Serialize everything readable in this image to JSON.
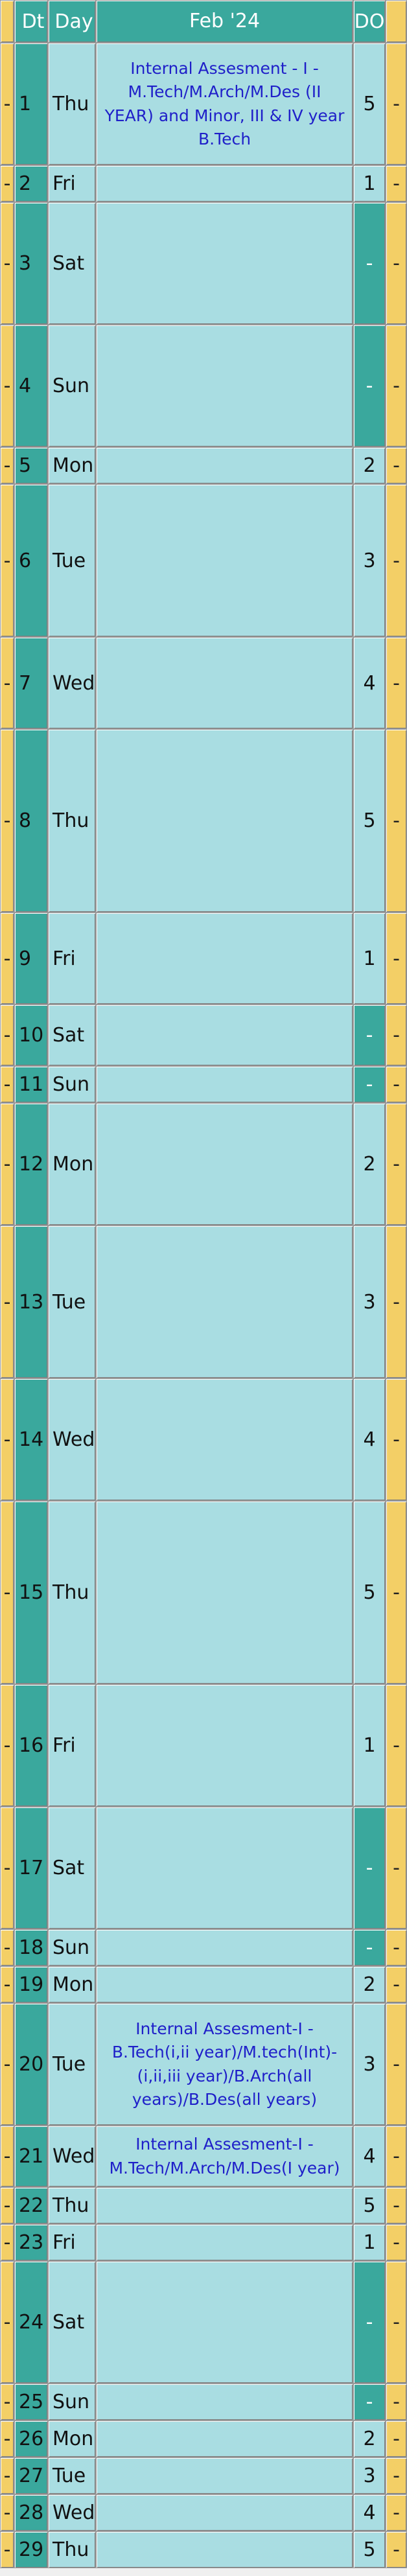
{
  "header": {
    "lead": "",
    "dt": "Dt",
    "day": "Day",
    "month": "Feb '24",
    "do": "DO",
    "trail": ""
  },
  "rows": [
    {
      "lead": "-",
      "dt": "1",
      "day": "Thu",
      "event": "Internal Assesment - I - M.Tech/M.Arch/M.Des (II YEAR) and Minor, III & IV year B.Tech",
      "do": "5",
      "trail": "-",
      "holiday": false
    },
    {
      "lead": "-",
      "dt": "2",
      "day": "Fri",
      "event": "",
      "do": "1",
      "trail": "-",
      "holiday": false
    },
    {
      "lead": "-",
      "dt": "3",
      "day": "Sat",
      "event": "",
      "do": "-",
      "trail": "-",
      "holiday": true
    },
    {
      "lead": "-",
      "dt": "4",
      "day": "Sun",
      "event": "",
      "do": "-",
      "trail": "-",
      "holiday": true
    },
    {
      "lead": "-",
      "dt": "5",
      "day": "Mon",
      "event": "",
      "do": "2",
      "trail": "-",
      "holiday": false
    },
    {
      "lead": "-",
      "dt": "6",
      "day": "Tue",
      "event": "",
      "do": "3",
      "trail": "-",
      "holiday": false
    },
    {
      "lead": "-",
      "dt": "7",
      "day": "Wed",
      "event": "",
      "do": "4",
      "trail": "-",
      "holiday": false
    },
    {
      "lead": "-",
      "dt": "8",
      "day": "Thu",
      "event": "",
      "do": "5",
      "trail": "-",
      "holiday": false
    },
    {
      "lead": "-",
      "dt": "9",
      "day": "Fri",
      "event": "",
      "do": "1",
      "trail": "-",
      "holiday": false
    },
    {
      "lead": "-",
      "dt": "10",
      "day": "Sat",
      "event": "",
      "do": "-",
      "trail": "-",
      "holiday": true
    },
    {
      "lead": "-",
      "dt": "11",
      "day": "Sun",
      "event": "",
      "do": "-",
      "trail": "-",
      "holiday": true
    },
    {
      "lead": "-",
      "dt": "12",
      "day": "Mon",
      "event": "",
      "do": "2",
      "trail": "-",
      "holiday": false
    },
    {
      "lead": "-",
      "dt": "13",
      "day": "Tue",
      "event": "",
      "do": "3",
      "trail": "-",
      "holiday": false
    },
    {
      "lead": "-",
      "dt": "14",
      "day": "Wed",
      "event": "",
      "do": "4",
      "trail": "-",
      "holiday": false
    },
    {
      "lead": "-",
      "dt": "15",
      "day": "Thu",
      "event": "",
      "do": "5",
      "trail": "-",
      "holiday": false
    },
    {
      "lead": "-",
      "dt": "16",
      "day": "Fri",
      "event": "",
      "do": "1",
      "trail": "-",
      "holiday": false
    },
    {
      "lead": "-",
      "dt": "17",
      "day": "Sat",
      "event": "",
      "do": "-",
      "trail": "-",
      "holiday": true
    },
    {
      "lead": "-",
      "dt": "18",
      "day": "Sun",
      "event": "",
      "do": "-",
      "trail": "-",
      "holiday": true
    },
    {
      "lead": "-",
      "dt": "19",
      "day": "Mon",
      "event": "",
      "do": "2",
      "trail": "-",
      "holiday": false
    },
    {
      "lead": "-",
      "dt": "20",
      "day": "Tue",
      "event": "Internal Assesment-I - B.Tech(i,ii year)/M.tech(Int)-(i,ii,iii year)/B.Arch(all years)/B.Des(all years)",
      "do": "3",
      "trail": "-",
      "holiday": false
    },
    {
      "lead": "-",
      "dt": "21",
      "day": "Wed",
      "event": "Internal Assesment-I - M.Tech/M.Arch/M.Des(I year)",
      "do": "4",
      "trail": "-",
      "holiday": false
    },
    {
      "lead": "-",
      "dt": "22",
      "day": "Thu",
      "event": "",
      "do": "5",
      "trail": "-",
      "holiday": false
    },
    {
      "lead": "-",
      "dt": "23",
      "day": "Fri",
      "event": "",
      "do": "1",
      "trail": "-",
      "holiday": false
    },
    {
      "lead": "-",
      "dt": "24",
      "day": "Sat",
      "event": "",
      "do": "-",
      "trail": "-",
      "holiday": true
    },
    {
      "lead": "-",
      "dt": "25",
      "day": "Sun",
      "event": "",
      "do": "-",
      "trail": "-",
      "holiday": true
    },
    {
      "lead": "-",
      "dt": "26",
      "day": "Mon",
      "event": "",
      "do": "2",
      "trail": "-",
      "holiday": false
    },
    {
      "lead": "-",
      "dt": "27",
      "day": "Tue",
      "event": "",
      "do": "3",
      "trail": "-",
      "holiday": false
    },
    {
      "lead": "-",
      "dt": "28",
      "day": "Wed",
      "event": "",
      "do": "4",
      "trail": "-",
      "holiday": false
    },
    {
      "lead": "-",
      "dt": "29",
      "day": "Thu",
      "event": "",
      "do": "5",
      "trail": "-",
      "holiday": false
    }
  ],
  "colors": {
    "accent_teal": "#3aa89d",
    "cell_blue": "#a9dde2",
    "side_gold": "#f3cf66",
    "event_text": "#1f1fc9"
  }
}
